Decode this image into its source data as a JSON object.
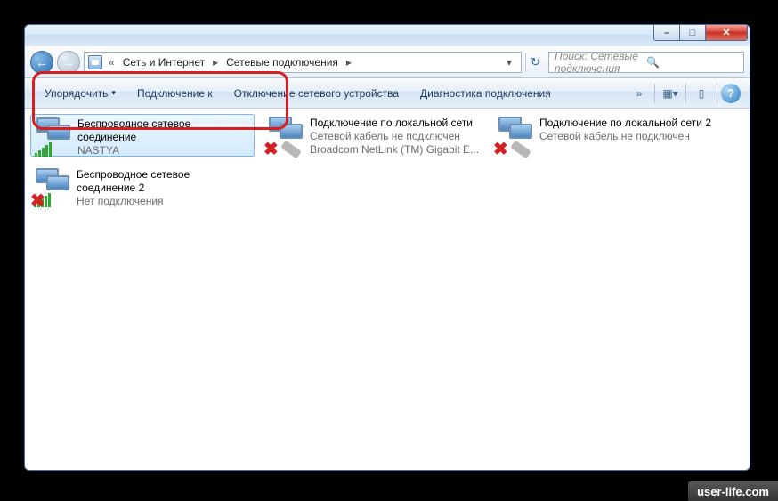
{
  "titlebar": {
    "min_label": "–",
    "max_label": "□",
    "close_label": "✕"
  },
  "nav": {
    "back_glyph": "←",
    "forward_glyph": "→",
    "chevrons": "«",
    "crumb1": "Сеть и Интернет",
    "crumb2": "Сетевые подключения",
    "sep": "▸",
    "dropdown_glyph": "▾",
    "refresh_glyph": "↻"
  },
  "search": {
    "placeholder": "Поиск: Сетевые подключения",
    "icon": "🔍"
  },
  "toolbar": {
    "organize": "Упорядочить",
    "connect": "Подключение к",
    "disable": "Отключение сетевого устройства",
    "diagnose": "Диагностика подключения",
    "arrow": "▾",
    "chevron": "»",
    "view_glyph": "▦",
    "preview_glyph": "▯",
    "help_glyph": "?"
  },
  "items": [
    {
      "title": "Беспроводное сетевое соединение",
      "sub": "NASTYA",
      "type": "wifi",
      "selected": true,
      "error": false
    },
    {
      "title": "Подключение по локальной сети",
      "sub1": "Сетевой кабель не подключен",
      "sub2": "Broadcom NetLink (TM) Gigabit E...",
      "type": "lan",
      "error": true
    },
    {
      "title": "Подключение по локальной сети 2",
      "sub1": "Сетевой кабель не подключен",
      "type": "lan",
      "error": true
    },
    {
      "title": "Беспроводное сетевое соединение 2",
      "sub1": "Нет подключения",
      "type": "wifi",
      "error": true
    }
  ],
  "watermark": "user-life.com"
}
